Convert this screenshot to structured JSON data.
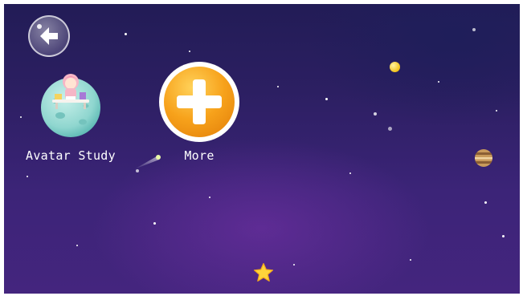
{
  "apps": [
    {
      "label": "Avatar Study",
      "icon": "avatar-study-planet-icon"
    },
    {
      "label": "More",
      "icon": "plus-icon"
    }
  ],
  "back": {
    "icon": "back-arrow-icon"
  },
  "colors": {
    "space_top": "#221c56",
    "space_bottom": "#44257e",
    "plus_orange": "#f7a21b",
    "planet_teal": "#8fd6cf"
  }
}
